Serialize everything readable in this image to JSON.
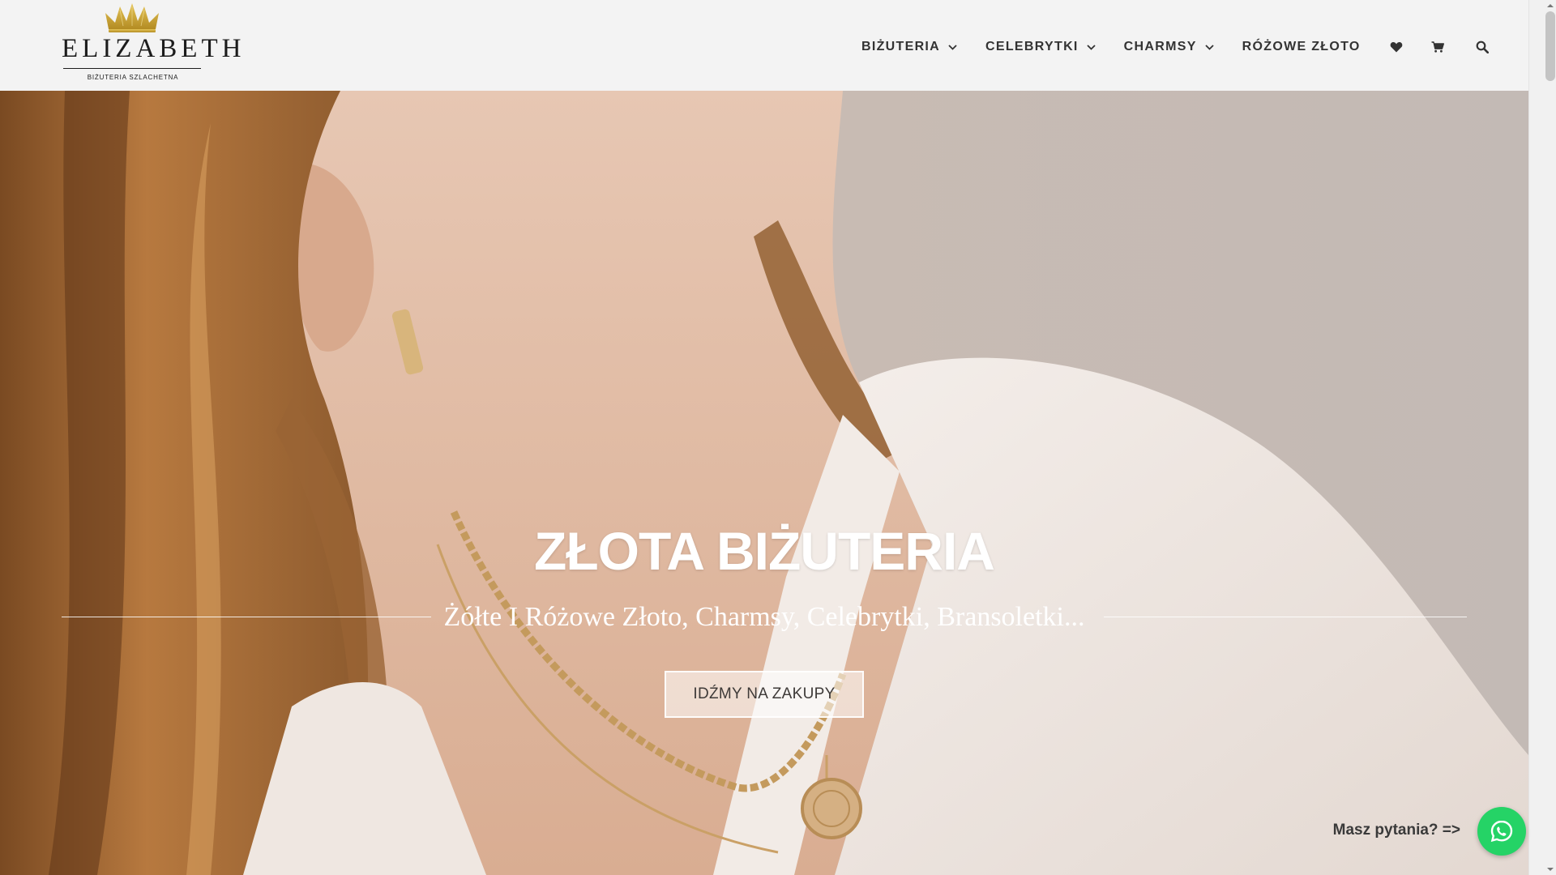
{
  "brand": {
    "name": "ELIZABETH",
    "tagline": "BIŻUTERIA SZLACHETNA",
    "crown_color": "#c9a63a"
  },
  "nav": {
    "items": [
      {
        "label": "BIŻUTERIA",
        "has_dropdown": true
      },
      {
        "label": "CELEBRYTKI",
        "has_dropdown": true
      },
      {
        "label": "CHARMSY",
        "has_dropdown": true
      },
      {
        "label": "RÓŻOWE ZŁOTO",
        "has_dropdown": false
      }
    ],
    "icons": [
      "heart-icon",
      "cart-icon",
      "search-icon"
    ]
  },
  "hero": {
    "title": "ZŁOTA BIŻUTERIA",
    "subtitle": "Żółte I Różowe Złoto, Charmsy, Celebrytki, Bransoletki...",
    "cta_label": "IDŹMY NA ZAKUPY"
  },
  "contact": {
    "help_text": "Masz pytania? =>",
    "whatsapp_icon": "whatsapp-icon",
    "whatsapp_color": "#25d366"
  },
  "colors": {
    "header_bg": "#f3f3f3",
    "nav_text": "#333333",
    "hero_text": "#ffffff"
  }
}
